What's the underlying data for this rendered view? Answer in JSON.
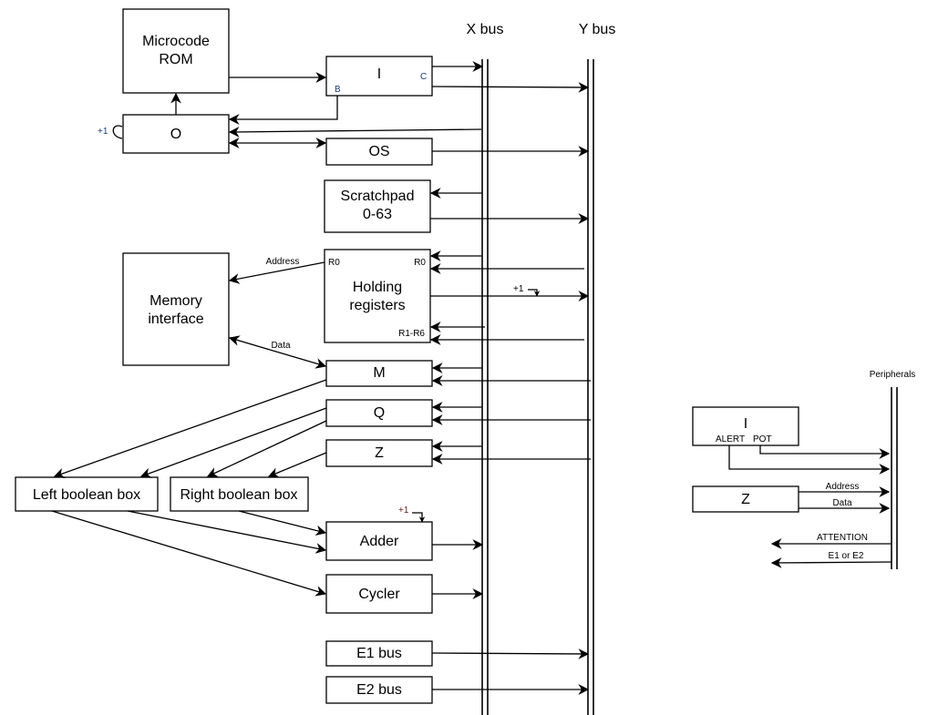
{
  "buses": {
    "x_bus": "X bus",
    "y_bus": "Y bus",
    "peripherals": "Peripherals"
  },
  "boxes": {
    "microcode_rom": [
      "Microcode",
      "ROM"
    ],
    "o": "O",
    "i": "I",
    "i_port_b": "B",
    "i_port_c": "C",
    "os": "OS",
    "scratchpad": [
      "Scratchpad",
      "0-63"
    ],
    "holding": [
      "Holding",
      "registers"
    ],
    "holding_r0_left": "R0",
    "holding_r0_right": "R0",
    "holding_r1r6": "R1-R6",
    "memory_interface": [
      "Memory",
      "interface"
    ],
    "m": "M",
    "q": "Q",
    "z": "Z",
    "left_boolean": "Left boolean box",
    "right_boolean": "Right boolean box",
    "adder": "Adder",
    "cycler": "Cycler",
    "e1_bus": "E1 bus",
    "e2_bus": "E2 bus",
    "periph_i": "I",
    "periph_i_alert": "ALERT",
    "periph_i_pot": "POT",
    "periph_z": "Z"
  },
  "labels": {
    "o_increment": "+1",
    "holding_increment": "+1",
    "adder_increment": "+1",
    "address": "Address",
    "data": "Data",
    "periph_address": "Address",
    "periph_data": "Data",
    "attention": "ATTENTION",
    "e1_or_e2": "E1 or E2"
  }
}
